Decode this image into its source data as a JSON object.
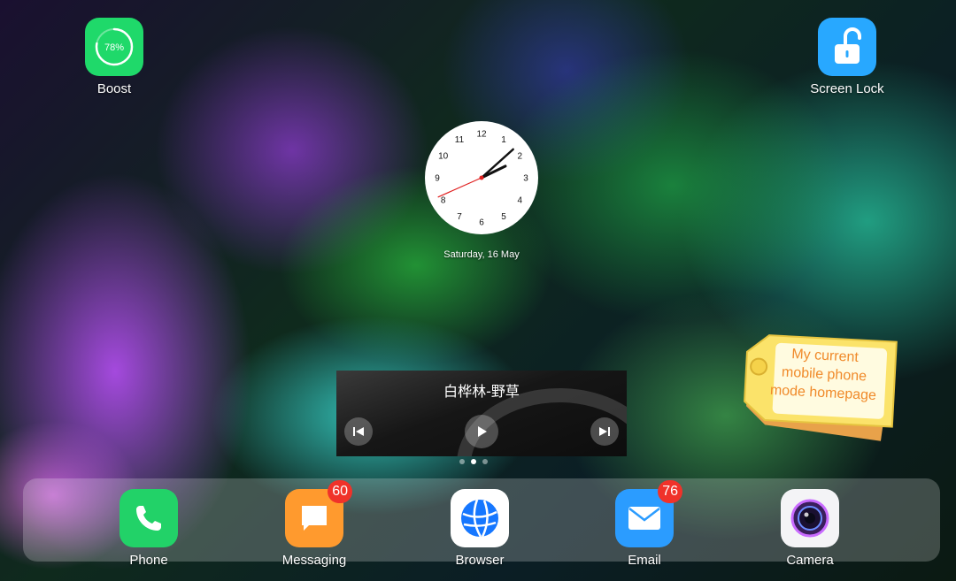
{
  "top_apps": {
    "boost": {
      "label": "Boost",
      "percent_text": "78%",
      "percent": 0.78
    },
    "screen_lock": {
      "label": "Screen Lock"
    }
  },
  "clock": {
    "date": "Saturday, 16 May",
    "hour": 2,
    "minute": 8,
    "second": 41,
    "numerals": [
      "12",
      "1",
      "2",
      "3",
      "4",
      "5",
      "6",
      "7",
      "8",
      "9",
      "10",
      "11"
    ]
  },
  "music": {
    "title": "白桦林-野草"
  },
  "pages": {
    "count": 3,
    "active": 1
  },
  "note": {
    "lines": [
      "My current",
      "mobile phone",
      "mode homepage"
    ]
  },
  "dock": {
    "phone": {
      "label": "Phone"
    },
    "messaging": {
      "label": "Messaging",
      "badge": "60"
    },
    "browser": {
      "label": "Browser"
    },
    "email": {
      "label": "Email",
      "badge": "76"
    },
    "camera": {
      "label": "Camera"
    }
  },
  "colors": {
    "boost_green": "#1fd96a",
    "lock_blue": "#28a8ff",
    "phone_green": "#22d268",
    "messaging_orange": "#ff9a2e",
    "email_blue": "#2b9cff",
    "badge_red": "#f0322a",
    "note_yellow": "#fbe36a",
    "note_text": "#f08a2a"
  }
}
